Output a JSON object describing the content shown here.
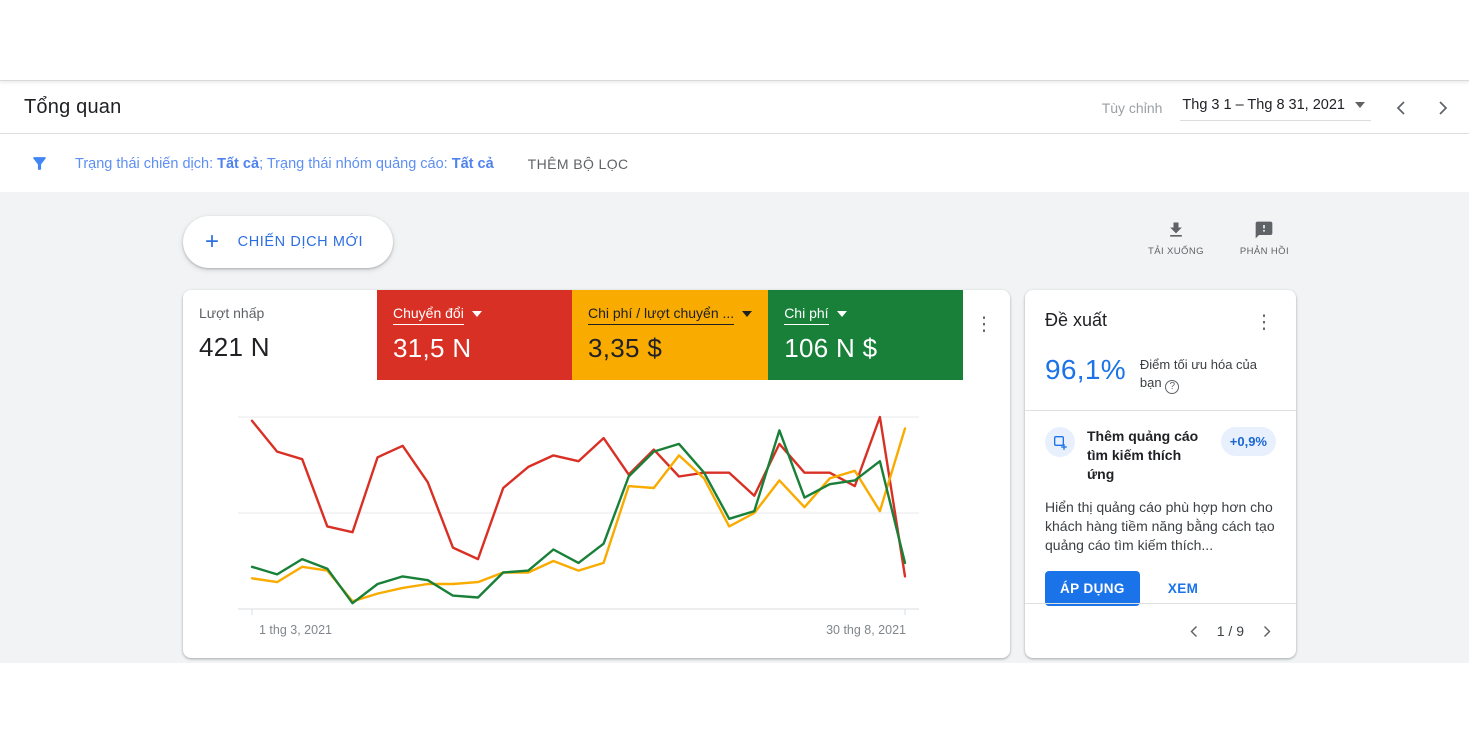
{
  "header": {
    "title": "Tổng quan",
    "date_preset_label": "Tùy chỉnh",
    "date_range": "Thg 3 1 – Thg 8 31, 2021"
  },
  "filter": {
    "label1": "Trạng thái chiến dịch: ",
    "value1": "Tất cả",
    "separator": "; ",
    "label2": "Trạng thái nhóm quảng cáo: ",
    "value2": "Tất cả",
    "add_filter_label": "THÊM BỘ LỌC"
  },
  "toolbar": {
    "new_campaign_label": "CHIẾN DỊCH MỚI",
    "download_label": "TẢI XUỐNG",
    "feedback_label": "PHẢN HỒI"
  },
  "icons": {
    "filter": "funnel-icon",
    "download": "download-icon",
    "feedback": "feedback-bubble-icon",
    "menu": "kebab-menu-icon",
    "help": "help-circle-icon",
    "recommendation": "responsive-search-ad-icon"
  },
  "colors": {
    "accent_blue": "#1a73e8",
    "tile_red": "#d93025",
    "tile_yellow": "#f9ab00",
    "tile_green": "#188038",
    "content_bg": "#f1f3f4",
    "uplift_badge_bg": "#e8f0fe",
    "uplift_badge_fg": "#1967d2"
  },
  "metrics": {
    "tiles": [
      {
        "id": "clicks",
        "label": "Lượt nhấp",
        "value": "421 N",
        "bg": "#ffffff",
        "fg": "#202124",
        "dropdown": false
      },
      {
        "id": "conversions",
        "label": "Chuyển đổi",
        "value": "31,5 N",
        "bg": "#d93025",
        "fg": "#ffffff",
        "dropdown": true
      },
      {
        "id": "cost-per-conversion",
        "label": "Chi phí / lượt chuyển ...",
        "value": "3,35 $",
        "bg": "#f9ab00",
        "fg": "#202124",
        "dropdown": true
      },
      {
        "id": "cost",
        "label": "Chi phí",
        "value": "106 N $",
        "bg": "#188038",
        "fg": "#ffffff",
        "dropdown": true
      }
    ]
  },
  "chart_data": {
    "type": "line",
    "x_start_label": "1 thg 3, 2021",
    "x_end_label": "30 thg 8, 2021",
    "x_unit": "weekly points, 1 Mar 2021 to 30 Aug 2021",
    "ylim": [
      0,
      100
    ],
    "y_note": "relative scale, no y-axis labels shown; 3 horizontal gridlines at 0/50/100",
    "grid": true,
    "legend_position": "none (colors match metric tiles)",
    "series": [
      {
        "name": "Chuyển đổi",
        "color": "#d93025",
        "values": [
          98,
          82,
          78,
          43,
          40,
          79,
          85,
          66,
          32,
          26,
          63,
          74,
          80,
          77,
          89,
          70,
          83,
          69,
          71,
          71,
          59,
          86,
          71,
          71,
          64,
          100,
          17
        ]
      },
      {
        "name": "Chi phí / lượt chuyển đổi",
        "color": "#f9ab00",
        "values": [
          16,
          14,
          22,
          20,
          4,
          8,
          11,
          13,
          13,
          14,
          19,
          19,
          25,
          20,
          24,
          64,
          63,
          80,
          68,
          43,
          50,
          67,
          53,
          68,
          72,
          51,
          94
        ]
      },
      {
        "name": "Chi phí",
        "color": "#188038",
        "values": [
          22,
          18,
          26,
          21,
          3,
          13,
          17,
          15,
          7,
          6,
          19,
          20,
          31,
          24,
          34,
          69,
          82,
          86,
          71,
          47,
          51,
          93,
          58,
          65,
          67,
          77,
          24
        ]
      }
    ]
  },
  "recommendations": {
    "title": "Đề xuất",
    "score": "96,1%",
    "score_label": "Điểm tối ưu hóa của bạn",
    "item": {
      "title": "Thêm quảng cáo tìm kiếm thích ứng",
      "uplift": "+0,9%",
      "description": "Hiển thị quảng cáo phù hợp hơn cho khách hàng tiềm năng bằng cách tạo quảng cáo tìm kiếm thích...",
      "apply_label": "ÁP DỤNG",
      "view_label": "XEM"
    },
    "pagination": "1 / 9"
  }
}
